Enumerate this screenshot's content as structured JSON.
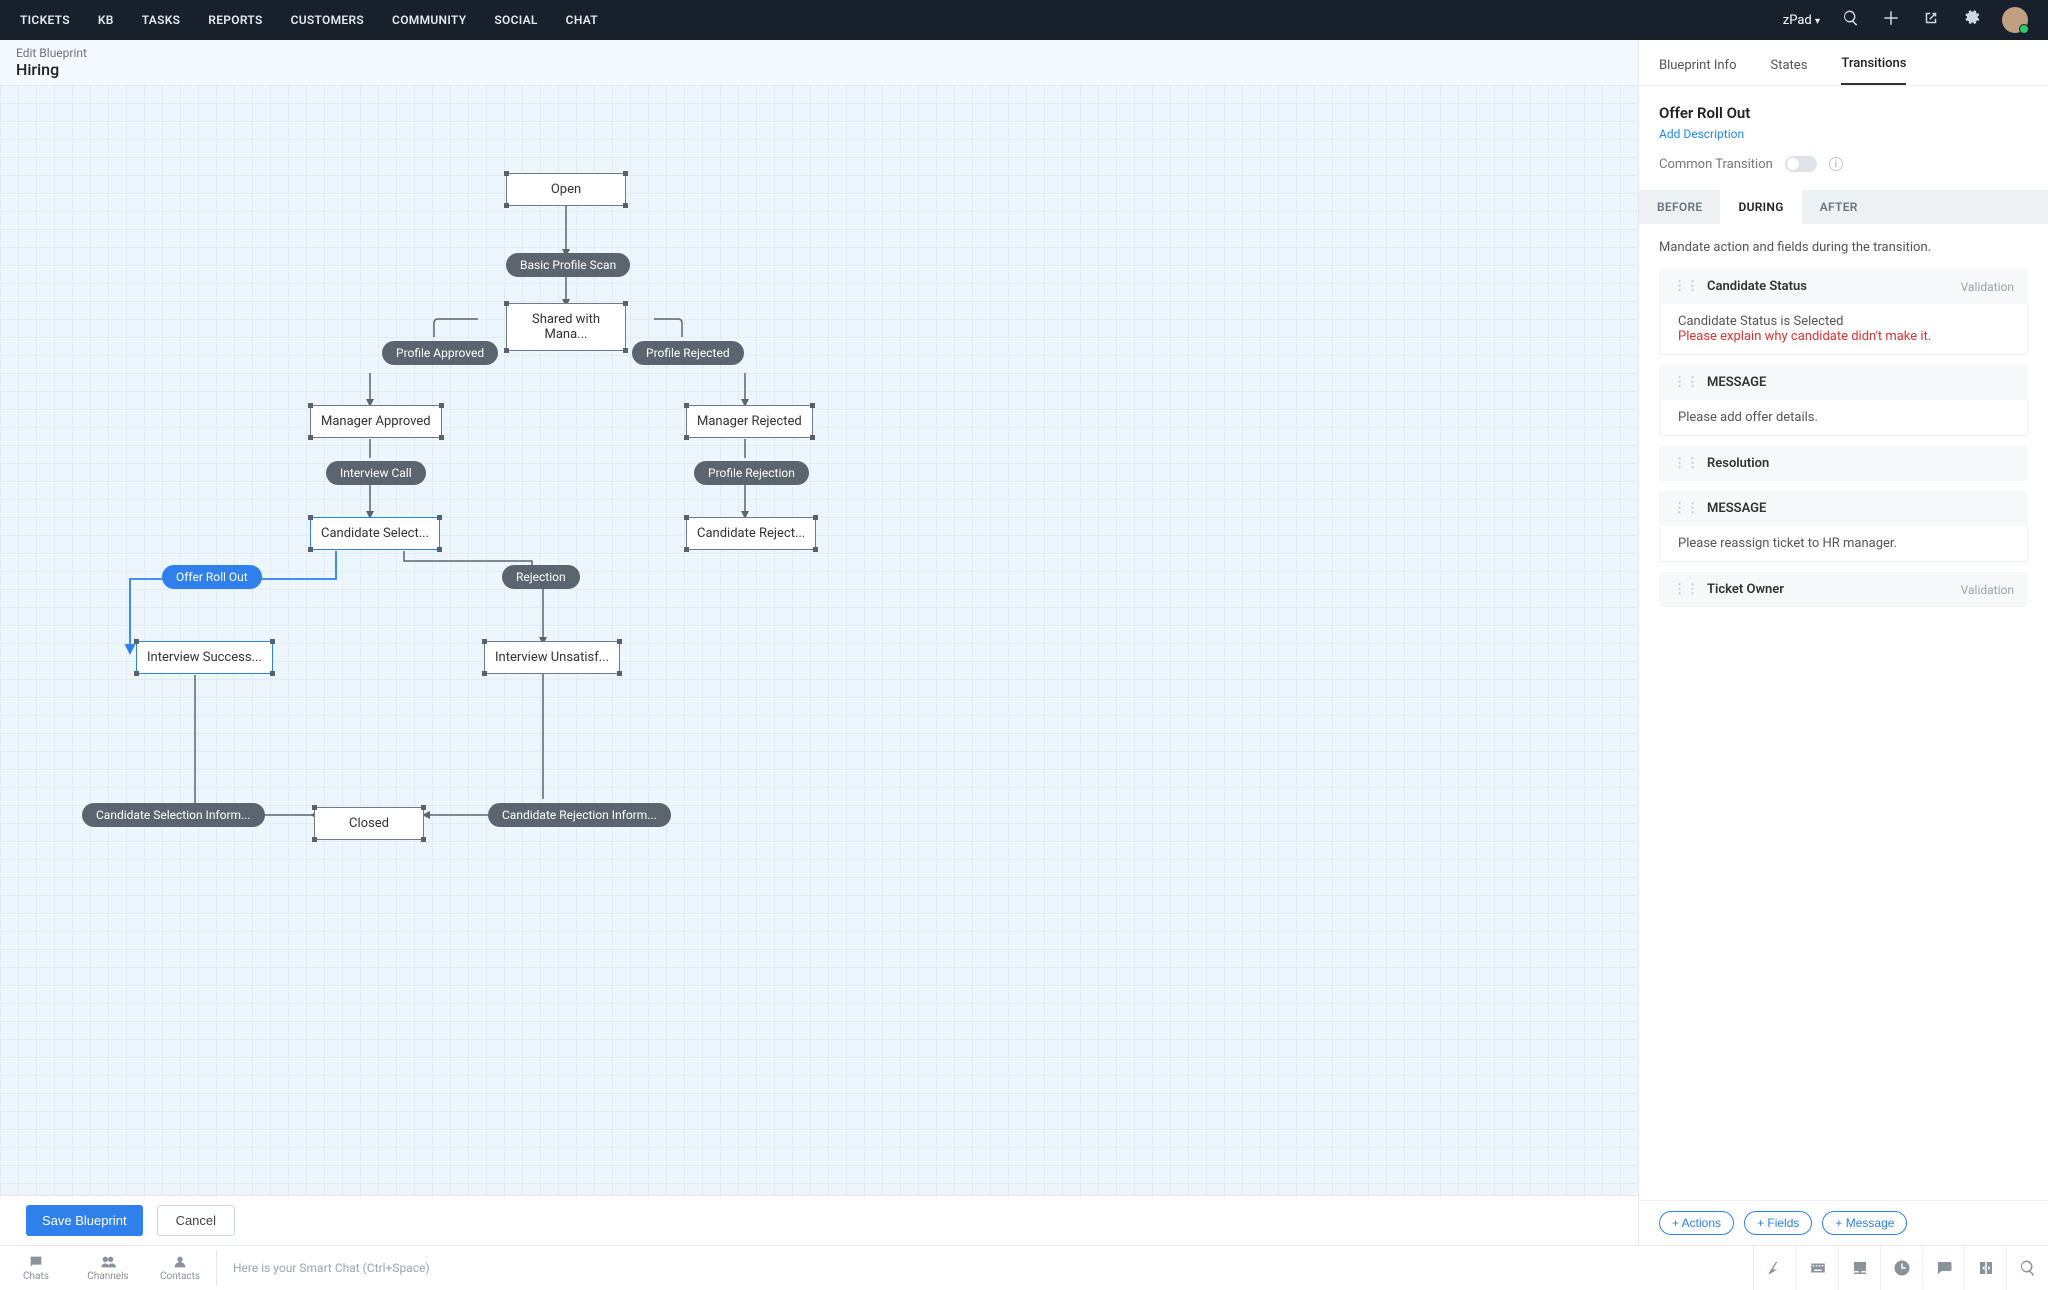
{
  "nav": [
    "TICKETS",
    "KB",
    "TASKS",
    "REPORTS",
    "CUSTOMERS",
    "COMMUNITY",
    "SOCIAL",
    "CHAT"
  ],
  "zpad": "zPad",
  "canvas": {
    "breadcrumb": "Edit Blueprint",
    "title": "Hiring",
    "save": "Save Blueprint",
    "cancel": "Cancel",
    "states": {
      "open": "Open",
      "shared": "Shared with Mana...",
      "mgr_appr": "Manager Approved",
      "mgr_rej": "Manager Rejected",
      "cand_sel": "Candidate Select...",
      "cand_rej": "Candidate Reject...",
      "int_succ": "Interview Success...",
      "int_unsat": "Interview Unsatisf...",
      "closed": "Closed"
    },
    "transitions": {
      "basic_scan": "Basic Profile Scan",
      "prof_appr": "Profile Approved",
      "prof_rej": "Profile Rejected",
      "int_call": "Interview Call",
      "prof_rejection": "Profile Rejection",
      "offer": "Offer Roll Out",
      "rejection": "Rejection",
      "cand_sel_inform": "Candidate Selection Inform...",
      "cand_rej_inform": "Candidate Rejection Inform..."
    }
  },
  "side": {
    "tabs": [
      "Blueprint Info",
      "States",
      "Transitions"
    ],
    "active_tab": 2,
    "title": "Offer Roll Out",
    "add_desc": "Add Description",
    "common_transition": "Common Transition",
    "segments": [
      "BEFORE",
      "DURING",
      "AFTER"
    ],
    "active_seg": 1,
    "hint": "Mandate action and fields during the transition.",
    "items": [
      {
        "title": "Candidate Status",
        "right": "Validation",
        "lines": [
          "Candidate Status is  Selected"
        ],
        "err": "Please explain why candidate didn't make it."
      },
      {
        "title": "MESSAGE",
        "lines": [
          "Please add offer details."
        ]
      },
      {
        "title": "Resolution"
      },
      {
        "title": "MESSAGE",
        "lines": [
          "Please reassign ticket to HR manager."
        ]
      },
      {
        "title": "Ticket Owner",
        "right": "Validation"
      }
    ],
    "pills": [
      "+ Actions",
      "+ Fields",
      "+ Message"
    ]
  },
  "chat": {
    "tabs": [
      "Chats",
      "Channels",
      "Contacts"
    ],
    "placeholder": "Here is your Smart Chat (Ctrl+Space)"
  },
  "icons": {
    "search": "search-icon",
    "plus": "plus-icon",
    "popout": "popout-icon",
    "gear": "gear-icon",
    "caret": "chevron-down-icon",
    "info": "info-icon",
    "chat": "chat-icon",
    "channels": "channels-icon",
    "contacts": "contact-icon",
    "zia": "zia-icon",
    "kbd": "keyboard-icon",
    "inbox": "inbox-icon",
    "clock": "clock-icon",
    "bubble": "speech-icon",
    "colsplit": "collapse-icon",
    "mag": "magnify-icon"
  }
}
